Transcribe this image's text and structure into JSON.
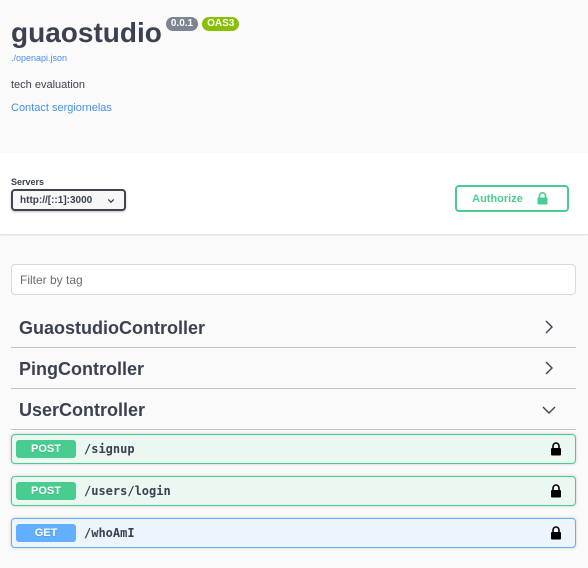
{
  "info": {
    "title": "guaostudio",
    "version": "0.0.1",
    "oas_badge": "OAS3",
    "spec_link": "./openapi.json",
    "description": "tech evaluation",
    "contact": "Contact sergiornelas"
  },
  "servers": {
    "label": "Servers",
    "selected": "http://[::1]:3000"
  },
  "authorize": {
    "label": "Authorize"
  },
  "filter": {
    "placeholder": "Filter by tag",
    "value": ""
  },
  "tags": [
    {
      "name": "GuaostudioController",
      "expanded": false
    },
    {
      "name": "PingController",
      "expanded": false
    },
    {
      "name": "UserController",
      "expanded": true
    }
  ],
  "operations": [
    {
      "method": "POST",
      "path": "/signup",
      "locked": true
    },
    {
      "method": "POST",
      "path": "/users/login",
      "locked": true
    },
    {
      "method": "GET",
      "path": "/whoAmI",
      "locked": true
    }
  ],
  "colors": {
    "post": "#49cc90",
    "get": "#61affe",
    "link": "#4990e2",
    "text": "#3b4151"
  }
}
